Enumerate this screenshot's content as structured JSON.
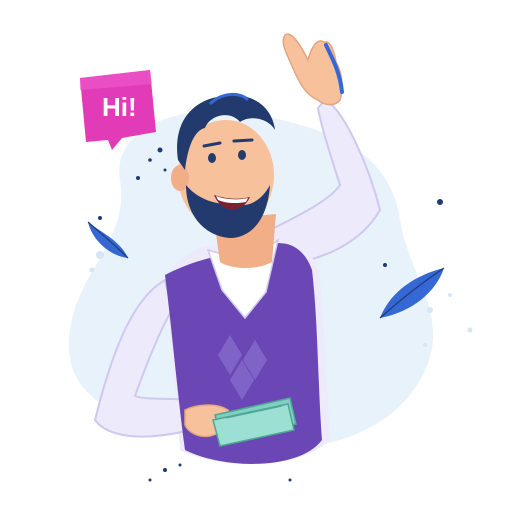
{
  "speech_bubble": {
    "text": "Hi!",
    "color": "#e23bb8"
  },
  "colors": {
    "blob": "#e8f2fb",
    "hair": "#223a6e",
    "skin": "#f7c19b",
    "shirt": "#eceafb",
    "vest": "#6a47b4",
    "leaves": "#3568d4",
    "money": "#7fd0c0"
  },
  "icons": [
    "speech-bubble-icon",
    "leaf-icon",
    "banknotes-icon"
  ]
}
